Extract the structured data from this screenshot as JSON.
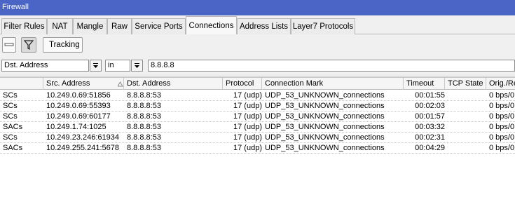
{
  "window": {
    "title": "Firewall"
  },
  "tabs": [
    {
      "label": "Filter Rules"
    },
    {
      "label": "NAT"
    },
    {
      "label": "Mangle"
    },
    {
      "label": "Raw"
    },
    {
      "label": "Service Ports"
    },
    {
      "label": "Connections",
      "active": true
    },
    {
      "label": "Address Lists"
    },
    {
      "label": "Layer7 Protocols"
    }
  ],
  "toolbar": {
    "minus_icon": "minus-icon",
    "filter_icon": "funnel-icon",
    "tracking_label": "Tracking"
  },
  "filter": {
    "field": "Dst. Address",
    "operator": "in",
    "value": "8.8.8.8"
  },
  "table": {
    "columns": [
      "Src. Address",
      "Dst. Address",
      "Protocol",
      "Connection Mark",
      "Timeout",
      "TCP State",
      "Orig./Re"
    ],
    "rows": [
      {
        "comment": "SCs",
        "src": "10.249.0.69:51856",
        "dst": "8.8.8.8:53",
        "protocol": "17 (udp)",
        "mark": "UDP_53_UNKNOWN_connections",
        "timeout": "00:01:55",
        "tcp_state": "",
        "rate": "0 bps/0"
      },
      {
        "comment": "SCs",
        "src": "10.249.0.69:55393",
        "dst": "8.8.8.8:53",
        "protocol": "17 (udp)",
        "mark": "UDP_53_UNKNOWN_connections",
        "timeout": "00:02:03",
        "tcp_state": "",
        "rate": "0 bps/0"
      },
      {
        "comment": "SCs",
        "src": "10.249.0.69:60177",
        "dst": "8.8.8.8:53",
        "protocol": "17 (udp)",
        "mark": "UDP_53_UNKNOWN_connections",
        "timeout": "00:01:57",
        "tcp_state": "",
        "rate": "0 bps/0"
      },
      {
        "comment": "SACs",
        "src": "10.249.1.74:1025",
        "dst": "8.8.8.8:53",
        "protocol": "17 (udp)",
        "mark": "UDP_53_UNKNOWN_connections",
        "timeout": "00:03:32",
        "tcp_state": "",
        "rate": "0 bps/0"
      },
      {
        "comment": "SCs",
        "src": "10.249.23.246:61934",
        "dst": "8.8.8.8:53",
        "protocol": "17 (udp)",
        "mark": "UDP_53_UNKNOWN_connections",
        "timeout": "00:02:31",
        "tcp_state": "",
        "rate": "0 bps/0"
      },
      {
        "comment": "SACs",
        "src": "10.249.255.241:5678",
        "dst": "8.8.8.8:53",
        "protocol": "17 (udp)",
        "mark": "UDP_53_UNKNOWN_connections",
        "timeout": "00:04:29",
        "tcp_state": "",
        "rate": "0 bps/0"
      }
    ]
  }
}
